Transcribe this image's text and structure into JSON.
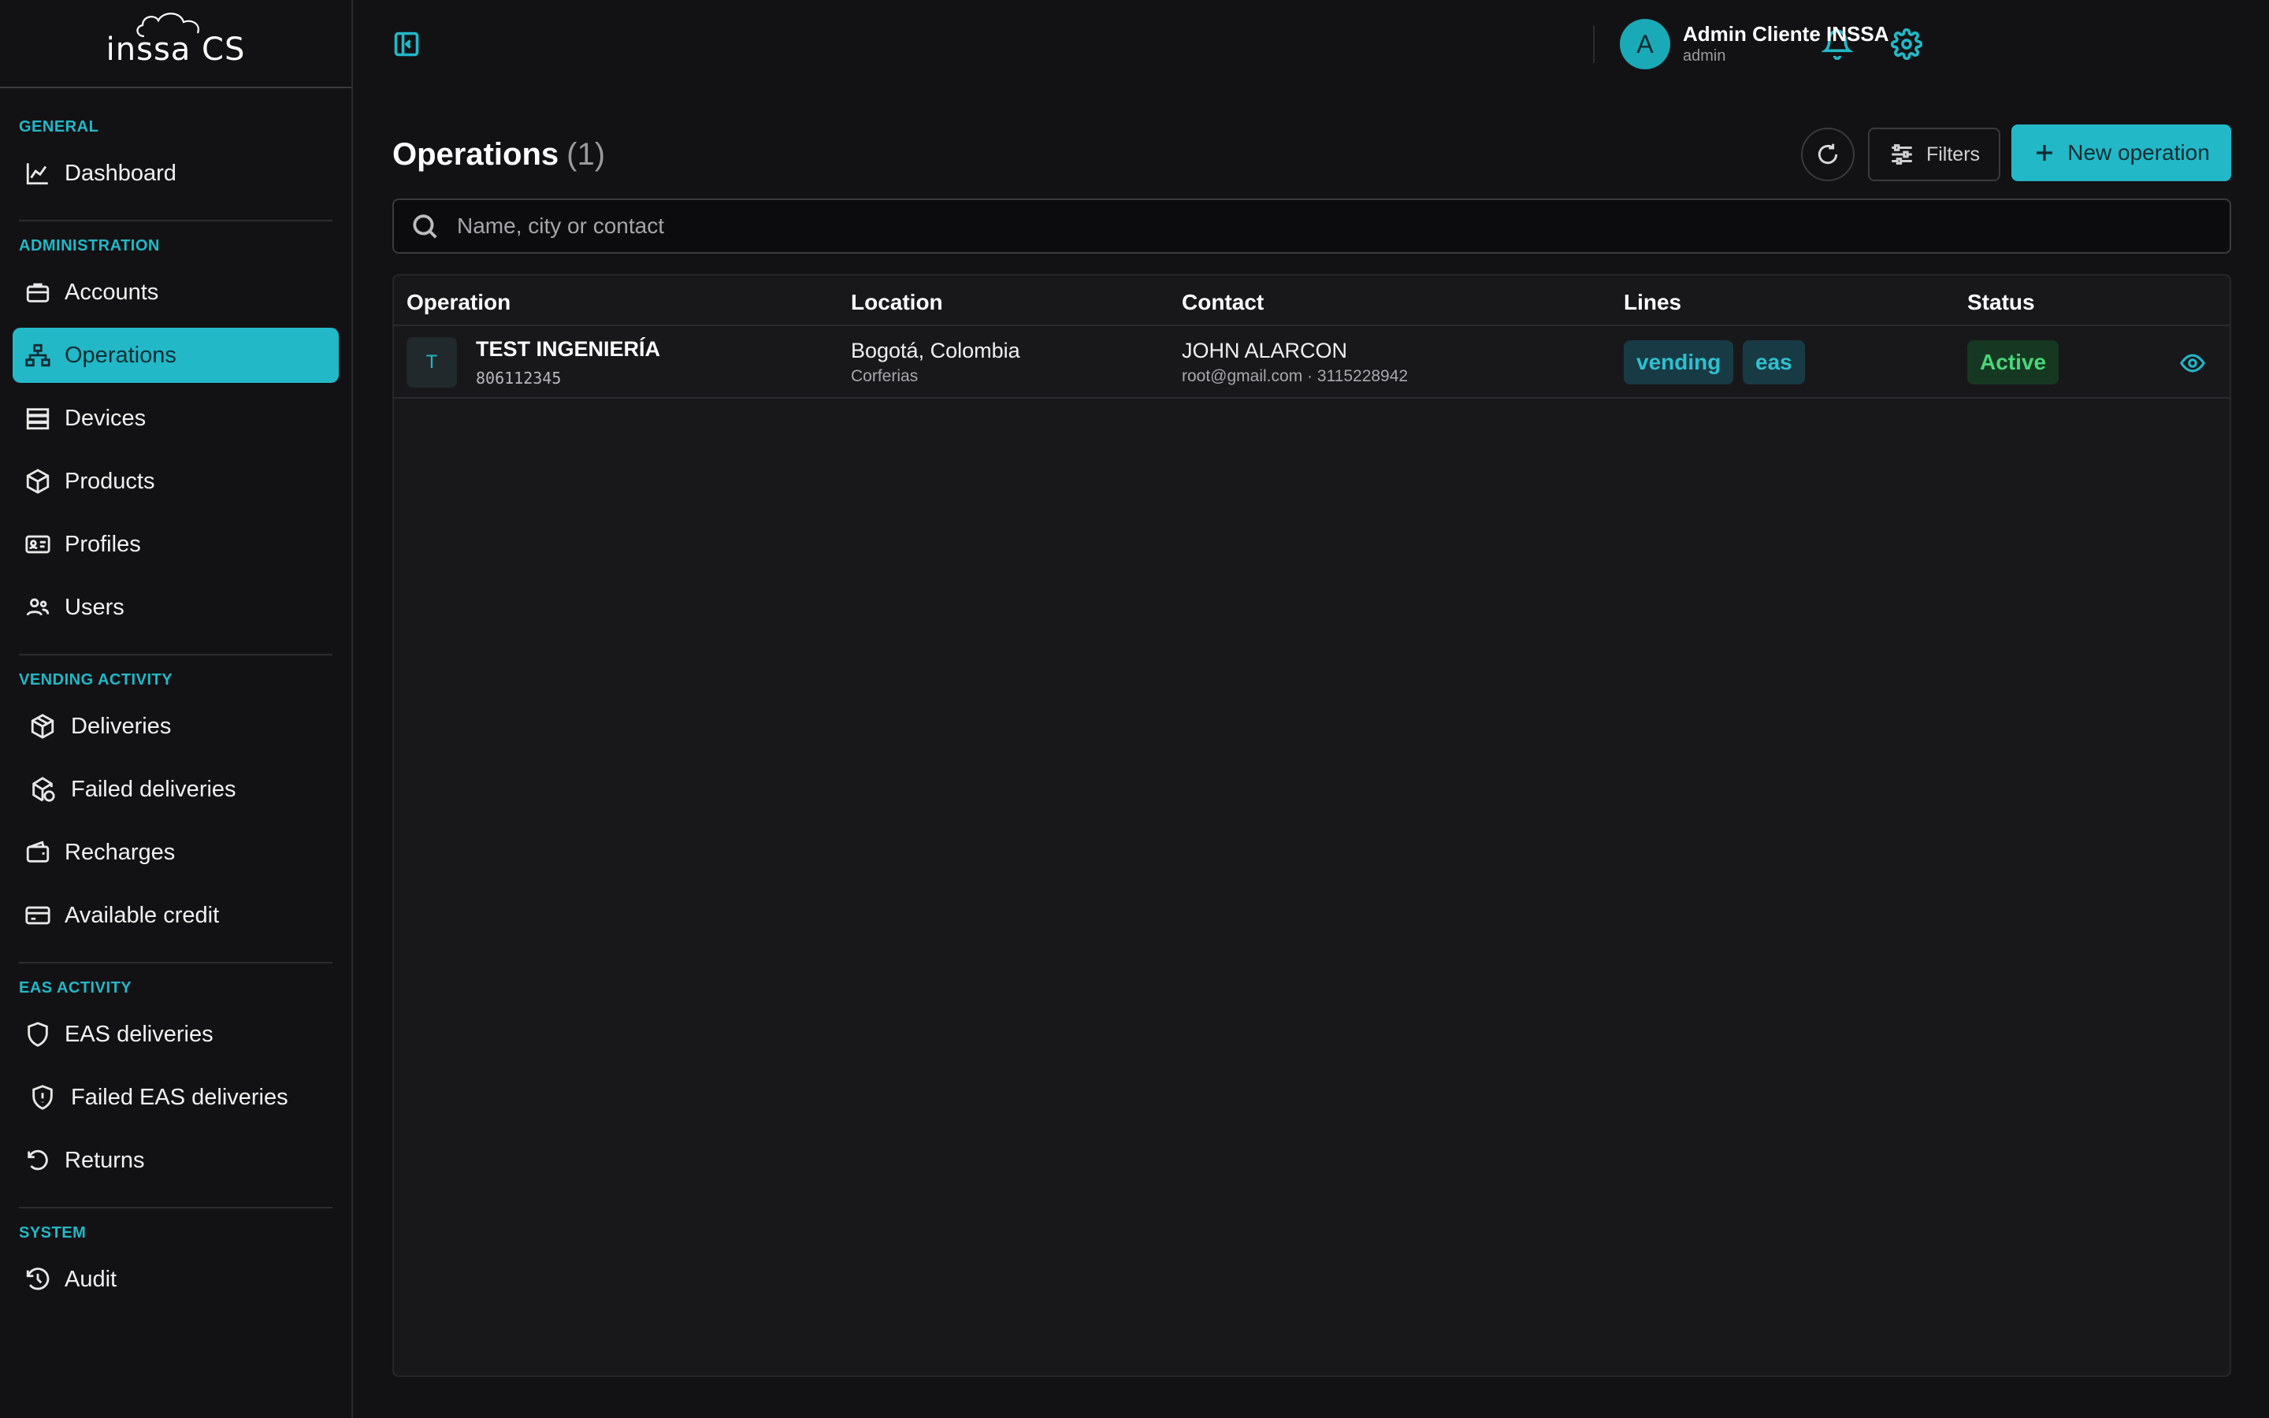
{
  "brand": {
    "logo_text": "inssa CS"
  },
  "sidebar": {
    "sections": [
      {
        "label": "GENERAL",
        "items": [
          {
            "label": "Dashboard",
            "icon": "chart-line-icon"
          }
        ]
      },
      {
        "label": "ADMINISTRATION",
        "items": [
          {
            "label": "Accounts",
            "icon": "briefcase-icon"
          },
          {
            "label": "Operations",
            "icon": "sitemap-icon",
            "active": true
          },
          {
            "label": "Devices",
            "icon": "server-icon"
          },
          {
            "label": "Products",
            "icon": "box-icon"
          },
          {
            "label": "Profiles",
            "icon": "id-card-icon"
          },
          {
            "label": "Users",
            "icon": "users-icon"
          }
        ]
      },
      {
        "label": "VENDING ACTIVITY",
        "items": [
          {
            "label": "Deliveries",
            "icon": "package-icon"
          },
          {
            "label": "Failed deliveries",
            "icon": "package-alert-icon"
          },
          {
            "label": "Recharges",
            "icon": "wallet-icon"
          },
          {
            "label": "Available credit",
            "icon": "credit-card-icon"
          }
        ]
      },
      {
        "label": "EAS ACTIVITY",
        "items": [
          {
            "label": "EAS deliveries",
            "icon": "shield-icon"
          },
          {
            "label": "Failed EAS deliveries",
            "icon": "shield-alert-icon"
          },
          {
            "label": "Returns",
            "icon": "rotate-ccw-icon"
          }
        ]
      },
      {
        "label": "SYSTEM",
        "items": [
          {
            "label": "Audit",
            "icon": "history-icon"
          }
        ]
      }
    ]
  },
  "header": {
    "user_initial": "A",
    "user_name": "Admin Cliente INSSA",
    "user_role": "admin"
  },
  "main": {
    "title": "Operations",
    "count": "(1)",
    "filters_label": "Filters",
    "new_label": "New operation",
    "search_placeholder": "Name, city or contact",
    "columns": [
      "Operation",
      "Location",
      "Contact",
      "Lines",
      "Status"
    ],
    "rows": [
      {
        "initial": "T",
        "name": "TEST INGENIERÍA",
        "code": "806112345",
        "location": "Bogotá, Colombia",
        "location_sub": "Corferias",
        "contact": "JOHN ALARCON",
        "contact_sub": "root@gmail.com · 3115228942",
        "lines": [
          "vending",
          "eas"
        ],
        "status": "Active"
      }
    ]
  },
  "colors": {
    "accent": "#22b8c8",
    "status_active": "#4ad67a",
    "background": "#121214"
  }
}
